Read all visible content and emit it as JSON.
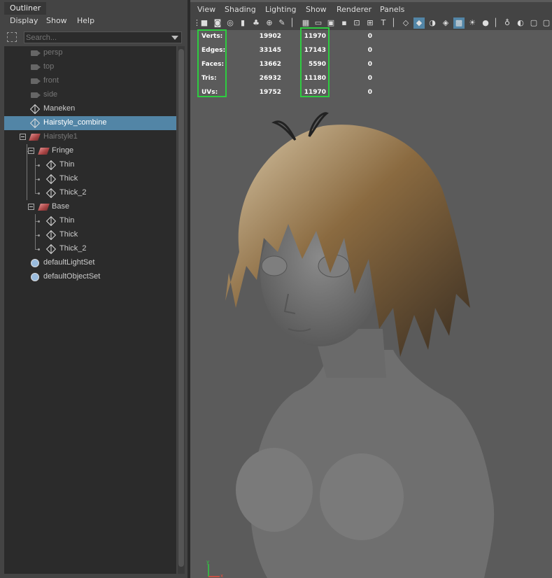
{
  "outliner": {
    "tab_label": "Outliner",
    "menu": [
      "Display",
      "Show",
      "Help"
    ],
    "search_placeholder": "Search...",
    "items": [
      {
        "label": "persp",
        "icon": "camera-icon",
        "state": "dim"
      },
      {
        "label": "top",
        "icon": "camera-icon",
        "state": "dim"
      },
      {
        "label": "front",
        "icon": "camera-icon",
        "state": "dim"
      },
      {
        "label": "side",
        "icon": "camera-icon",
        "state": "dim"
      },
      {
        "label": "Maneken",
        "icon": "mesh-icon",
        "state": "normal"
      },
      {
        "label": "Hairstyle_combine",
        "icon": "mesh-icon",
        "state": "selected"
      },
      {
        "label": "Hairstyle1",
        "icon": "group-icon",
        "state": "dim"
      },
      {
        "label": "Fringe",
        "icon": "group-icon",
        "state": "normal"
      },
      {
        "label": "Thin",
        "icon": "mesh-icon",
        "state": "normal"
      },
      {
        "label": "Thick",
        "icon": "mesh-icon",
        "state": "normal"
      },
      {
        "label": "Thick_2",
        "icon": "mesh-icon",
        "state": "normal"
      },
      {
        "label": "Base",
        "icon": "group-icon",
        "state": "normal"
      },
      {
        "label": "Thin",
        "icon": "mesh-icon",
        "state": "normal"
      },
      {
        "label": "Thick",
        "icon": "mesh-icon",
        "state": "normal"
      },
      {
        "label": "Thick_2",
        "icon": "mesh-icon",
        "state": "normal"
      },
      {
        "label": "defaultLightSet",
        "icon": "set-icon",
        "state": "normal"
      },
      {
        "label": "defaultObjectSet",
        "icon": "set-icon",
        "state": "normal"
      }
    ]
  },
  "viewport": {
    "menu": [
      "View",
      "Shading",
      "Lighting",
      "Show",
      "Renderer",
      "Panels"
    ],
    "hud": [
      {
        "label": "Verts:",
        "total": "19902",
        "selected": "11970",
        "components": "0"
      },
      {
        "label": "Edges:",
        "total": "33145",
        "selected": "17143",
        "components": "0"
      },
      {
        "label": "Faces:",
        "total": "13662",
        "selected": "5590",
        "components": "0"
      },
      {
        "label": "Tris:",
        "total": "26932",
        "selected": "11180",
        "components": "0"
      },
      {
        "label": "UVs:",
        "total": "19752",
        "selected": "11970",
        "components": "0"
      }
    ],
    "highlight_color": "#2ecc40",
    "selection_color": "#5285a6",
    "axis_labels": {
      "y": "y",
      "x": "x"
    }
  }
}
